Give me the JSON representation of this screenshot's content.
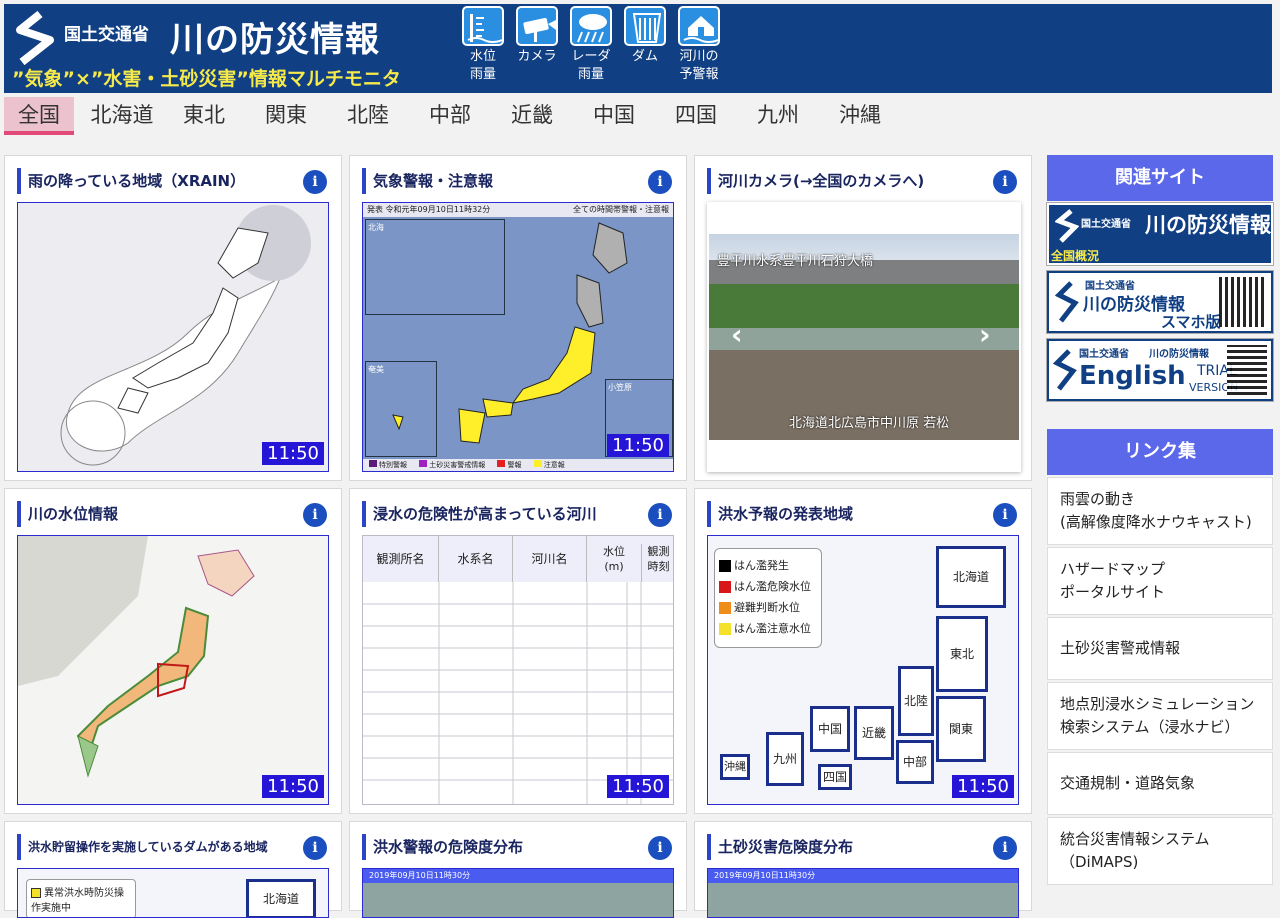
{
  "header": {
    "ministry": "国土交通省",
    "title": "川の防災情報",
    "subtitle": "”気象”×”水害・土砂災害”情報マルチモニタ",
    "icons": [
      {
        "name": "water-level-rain-icon",
        "line1": "水位",
        "line2": "雨量"
      },
      {
        "name": "camera-icon",
        "line1": "カメラ",
        "line2": ""
      },
      {
        "name": "radar-icon",
        "line1": "レーダ",
        "line2": "雨量"
      },
      {
        "name": "dam-icon",
        "line1": "ダム",
        "line2": ""
      },
      {
        "name": "river-forecast-icon",
        "line1": "河川の",
        "line2": "予警報"
      }
    ]
  },
  "tabs": [
    "全国",
    "北海道",
    "東北",
    "関東",
    "北陸",
    "中部",
    "近畿",
    "中国",
    "四国",
    "九州",
    "沖縄"
  ],
  "active_tab": "全国",
  "panels": {
    "p1": {
      "title": "雨の降っている地域（XRAIN）",
      "time": "11:50"
    },
    "p2": {
      "title": "気象警報・注意報",
      "time": "11:50",
      "legend": [
        "特別警報",
        "土砂災害警戒情報",
        "警報",
        "注意報"
      ],
      "header_text": "発表 令和元年09月10日11時32分",
      "header_right": "全ての時間帯警報・注意報",
      "regions": [
        "北海",
        "奄美",
        "小笠原"
      ]
    },
    "p3": {
      "title": "河川カメラ(→全国のカメラへ)",
      "caption_top": "豊平川水系豊平川石狩大橋",
      "caption_bottom": "北海道北広島市中川原 若松"
    },
    "p4": {
      "title": "川の水位情報",
      "time": "11:50"
    },
    "p5": {
      "title": "浸水の危険性が高まっている河川",
      "time": "11:50",
      "columns": [
        "観測所名",
        "水系名",
        "河川名",
        "水位\n(m)",
        "観測\n時刻"
      ]
    },
    "p6": {
      "title": "洪水予報の発表地域",
      "time": "11:50",
      "legend": [
        "はん濫発生",
        "はん濫危険水位",
        "避難判断水位",
        "はん濫注意水位"
      ],
      "regions": [
        "北海道",
        "東北",
        "北陸",
        "関東",
        "中部",
        "近畿",
        "中国",
        "四国",
        "九州",
        "沖縄"
      ]
    },
    "p7": {
      "title": "洪水貯留操作を実施しているダムがある地域",
      "legend": "異常洪水時防災操作実施中",
      "region": "北海道"
    },
    "p8": {
      "title": "洪水警報の危険度分布",
      "header_text": "2019年09月10日11時30分"
    },
    "p9": {
      "title": "土砂災害危険度分布",
      "header_text": "2019年09月10日11時30分"
    }
  },
  "sidebar": {
    "related_title": "関連サイト",
    "banners": [
      {
        "ministry": "国土交通省",
        "title": "川の防災情報",
        "sub": "全国概況"
      },
      {
        "ministry": "国土交通省",
        "title": "川の防災情報",
        "sub": "スマホ版"
      },
      {
        "ministry": "国土交通省",
        "title": "川の防災情報",
        "sub": "English",
        "trial": "TRIAL",
        "version": "VERSION"
      }
    ],
    "links_title": "リンク集",
    "links": [
      {
        "l1": "雨雲の動き",
        "l2": "(高解像度降水ナウキャスト)"
      },
      {
        "l1": "ハザードマップ",
        "l2": "ポータルサイト"
      },
      {
        "l1": "土砂災害警戒情報",
        "l2": ""
      },
      {
        "l1": "地点別浸水シミュレーション",
        "l2": "検索システム（浸水ナビ）"
      },
      {
        "l1": "交通規制・道路気象",
        "l2": ""
      },
      {
        "l1": "統合災害情報システム",
        "l2": "（DiMAPS)"
      }
    ]
  },
  "colors": {
    "header_bg": "#103f83",
    "subtitle": "#f6e94a",
    "accent": "#2b44c8",
    "time_badge": "#2515d6",
    "side_head": "#5b68ea"
  }
}
